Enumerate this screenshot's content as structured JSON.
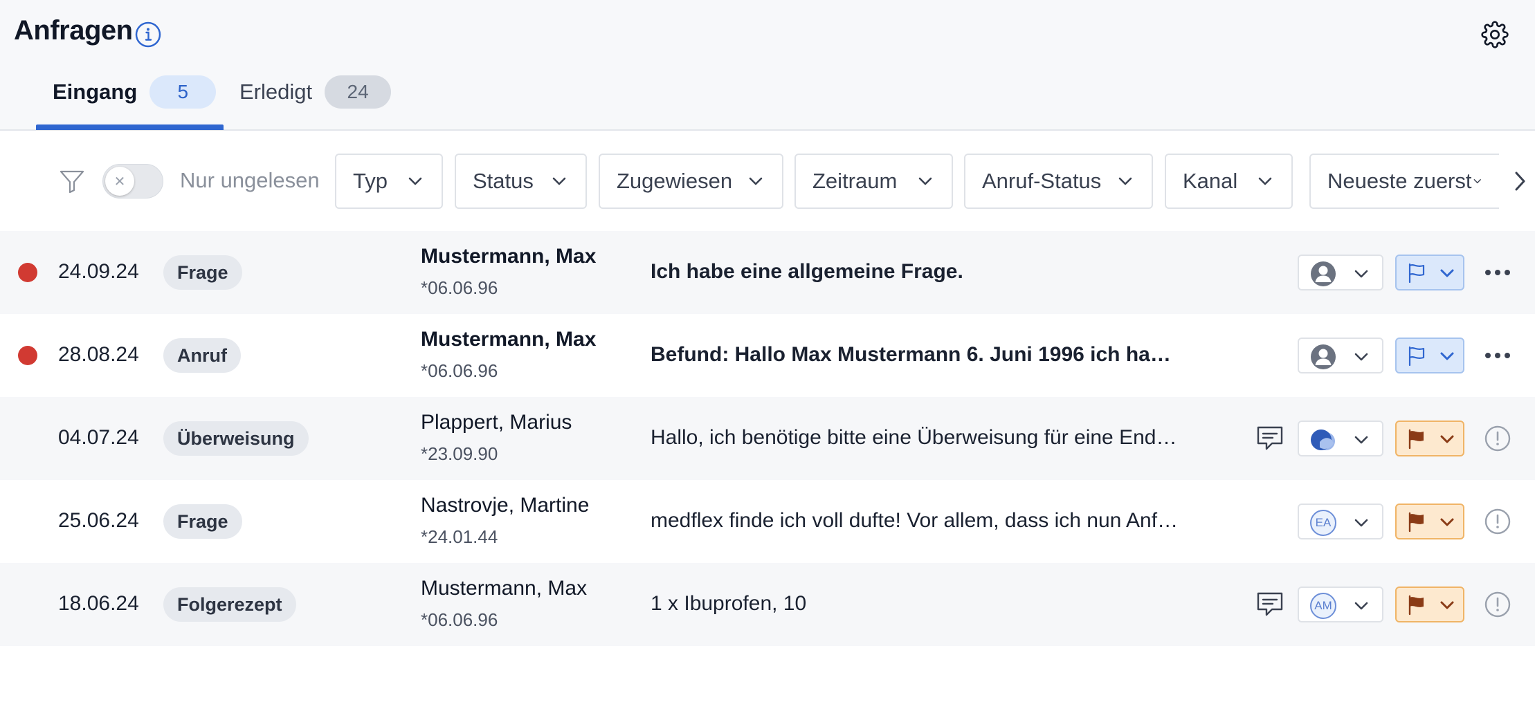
{
  "header": {
    "title": "Anfragen",
    "tabs": [
      {
        "label": "Eingang",
        "count": "5",
        "active": true
      },
      {
        "label": "Erledigt",
        "count": "24",
        "active": false
      }
    ]
  },
  "filters": {
    "unread_toggle_label": "Nur ungelesen",
    "unread_toggle_on": false,
    "dropdowns": [
      "Typ",
      "Status",
      "Zugewiesen",
      "Zeitraum",
      "Anruf-Status",
      "Kanal",
      "Neueste zuerst"
    ]
  },
  "rows": [
    {
      "unread": true,
      "date": "24.09.24",
      "type": "Frage",
      "name": "Mustermann, Max",
      "dob": "*06.06.96",
      "message": "Ich habe eine allgemeine Frage.",
      "has_comment": false,
      "assignee": "generic-avatar",
      "flag_color": "blue",
      "action": "more"
    },
    {
      "unread": true,
      "date": "28.08.24",
      "type": "Anruf",
      "name": "Mustermann, Max",
      "dob": "*06.06.96",
      "message": "Befund:  Hallo Max Mustermann 6. Juni 1996 ich habe…",
      "has_comment": false,
      "assignee": "generic-avatar",
      "flag_color": "blue",
      "action": "more"
    },
    {
      "unread": false,
      "date": "04.07.24",
      "type": "Überweisung",
      "name": "Plappert, Marius",
      "dob": "*23.09.90",
      "message": "Hallo, ich benötige bitte eine Überweisung für eine End…",
      "has_comment": true,
      "assignee": "group-avatar",
      "flag_color": "orange",
      "action": "alert"
    },
    {
      "unread": false,
      "date": "25.06.24",
      "type": "Frage",
      "name": "Nastrovje, Martine",
      "dob": "*24.01.44",
      "message": "medflex finde ich voll dufte! Vor allem, dass ich nun Anf…",
      "has_comment": false,
      "assignee": "EA",
      "flag_color": "orange",
      "action": "alert"
    },
    {
      "unread": false,
      "date": "18.06.24",
      "type": "Folgerezept",
      "name": "Mustermann, Max",
      "dob": "*06.06.96",
      "message": "1 x Ibuprofen, 10",
      "has_comment": true,
      "assignee": "AM",
      "flag_color": "orange",
      "action": "alert"
    }
  ],
  "colors": {
    "accent": "#2f66d0",
    "unread_dot": "#d13a32",
    "flag_blue": "#dbe8fb",
    "flag_orange": "#fde9cf",
    "flag_orange_icon": "#8a3b16"
  },
  "icons": {
    "info": "info-icon",
    "settings": "gear-icon",
    "filter": "funnel-icon",
    "more": "more-horizontal-icon",
    "alert": "alert-circle-icon",
    "comment": "comment-icon",
    "flag": "flag-icon",
    "chevron": "chevron-down-icon",
    "scroll": "chevron-right-icon"
  }
}
